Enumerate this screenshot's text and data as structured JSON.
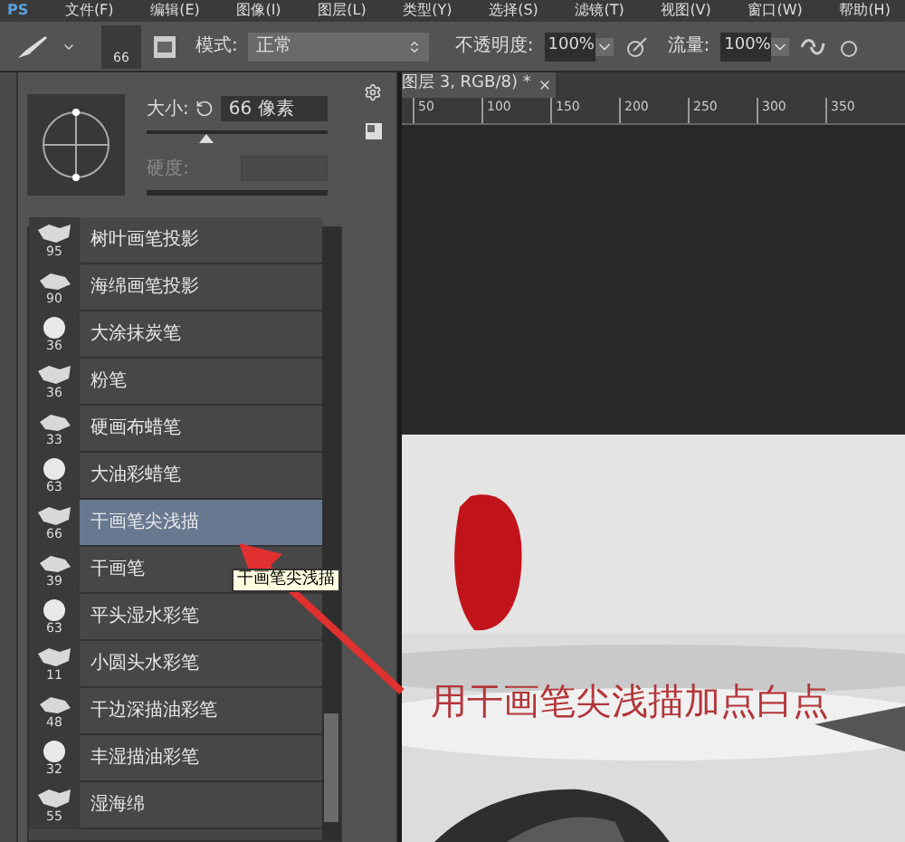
{
  "menu_bar": {
    "logo": "PS",
    "items": [
      "文件(F)",
      "编辑(E)",
      "图像(I)",
      "图层(L)",
      "类型(Y)",
      "选择(S)",
      "滤镜(T)",
      "视图(V)",
      "窗口(W)",
      "帮助(H)"
    ]
  },
  "options_bar": {
    "brush_size": "66",
    "mode_label": "模式:",
    "mode_value": "正常",
    "opacity_label": "不透明度:",
    "opacity_value": "100%",
    "flow_label": "流量:",
    "flow_value": "100%"
  },
  "brush_panel": {
    "size_label": "大小:",
    "size_value": "66 像素",
    "size_slider": {
      "level": 0.33
    },
    "hardness_label": "硬度:",
    "brushes": [
      {
        "name": "树叶画笔投影",
        "size": "95",
        "selected": false
      },
      {
        "name": "海绵画笔投影",
        "size": "90",
        "selected": false
      },
      {
        "name": "大涂抹炭笔",
        "size": "36",
        "selected": false
      },
      {
        "name": "粉笔",
        "size": "36",
        "selected": false
      },
      {
        "name": "硬画布蜡笔",
        "size": "33",
        "selected": false
      },
      {
        "name": "大油彩蜡笔",
        "size": "63",
        "selected": false
      },
      {
        "name": "干画笔尖浅描",
        "size": "66",
        "selected": true
      },
      {
        "name": "干画笔",
        "size": "39",
        "selected": false
      },
      {
        "name": "平头湿水彩笔",
        "size": "63",
        "selected": false
      },
      {
        "name": "小圆头水彩笔",
        "size": "11",
        "selected": false
      },
      {
        "name": "干边深描油彩笔",
        "size": "48",
        "selected": false
      },
      {
        "name": "丰湿描油彩笔",
        "size": "32",
        "selected": false
      },
      {
        "name": "湿海绵",
        "size": "55",
        "selected": false
      }
    ],
    "tooltip": "干画笔尖浅描"
  },
  "document": {
    "tab_title": "图层 3, RGB/8) *",
    "ruler_labels": [
      "50",
      "100",
      "150",
      "200",
      "250",
      "300",
      "350"
    ],
    "caption": "用干画笔尖浅描加点白点"
  }
}
